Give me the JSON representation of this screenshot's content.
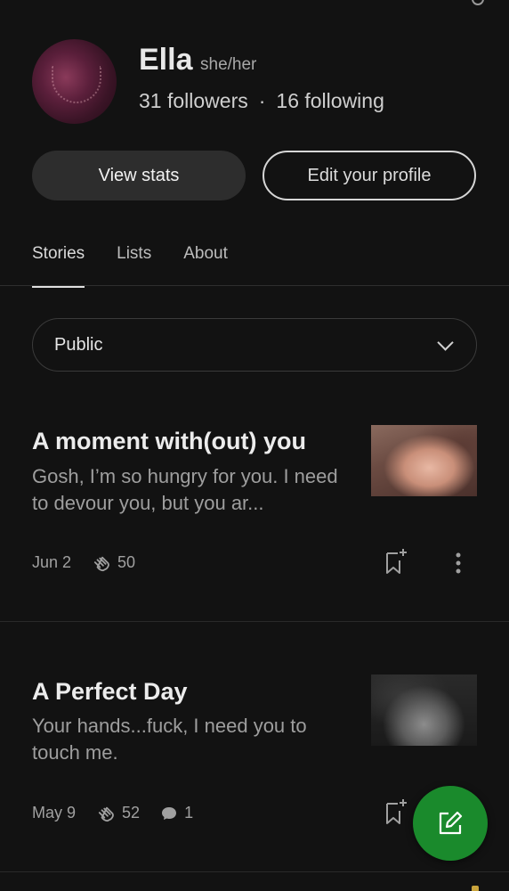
{
  "profile": {
    "name": "Ella",
    "pronouns": "she/her",
    "followers": "31 followers",
    "separator": "·",
    "following": "16 following"
  },
  "actions": {
    "view_stats": "View stats",
    "edit_profile": "Edit your profile"
  },
  "tabs": [
    {
      "label": "Stories",
      "active": true
    },
    {
      "label": "Lists",
      "active": false
    },
    {
      "label": "About",
      "active": false
    }
  ],
  "filter": {
    "selected": "Public",
    "icon": "chevron-down-icon"
  },
  "stories": [
    {
      "title": "A moment with(out) you",
      "excerpt": "Gosh, I’m so hungry for you. I need to devour you, but you ar...",
      "date": "Jun 2",
      "claps": "50",
      "responses": null
    },
    {
      "title": "A Perfect Day",
      "excerpt": "Your hands...fuck, I need you to touch me.",
      "date": "May 9",
      "claps": "52",
      "responses": "1"
    }
  ],
  "fab": {
    "icon": "edit-icon",
    "color": "#1a8a2c"
  },
  "colors": {
    "background": "#121212",
    "accent": "#1a8a2c"
  }
}
